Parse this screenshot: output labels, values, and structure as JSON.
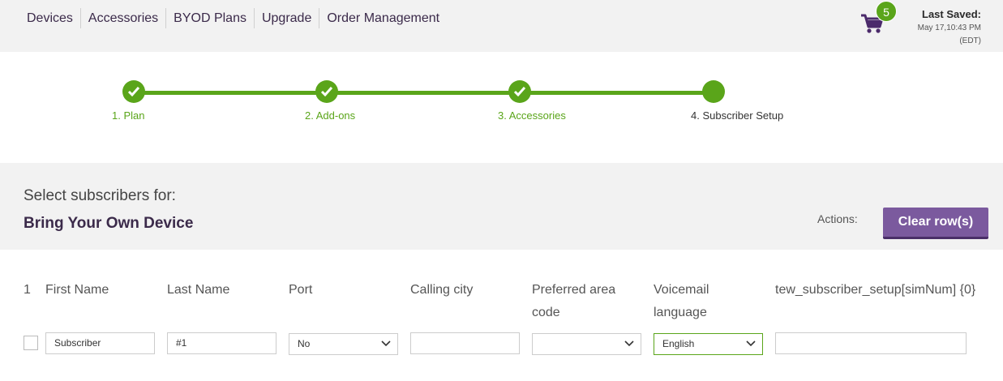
{
  "nav": {
    "items": [
      "Devices",
      "Accessories",
      "BYOD Plans",
      "Upgrade",
      "Order Management"
    ]
  },
  "cart": {
    "count": "5",
    "icon": "cart-icon"
  },
  "last_saved": {
    "title": "Last Saved:",
    "date": "May 17,10:43 PM",
    "tz": "(EDT)"
  },
  "steps": [
    {
      "label": "1. Plan",
      "status": "complete"
    },
    {
      "label": "2. Add-ons",
      "status": "complete"
    },
    {
      "label": "3. Accessories",
      "status": "complete"
    },
    {
      "label": "4. Subscriber Setup",
      "status": "current"
    }
  ],
  "subscriber_header": {
    "prompt": "Select subscribers for:",
    "plan": "Bring Your Own Device",
    "actions_label": "Actions:",
    "clear_button": "Clear row(s)"
  },
  "table": {
    "row_number": "1",
    "columns": [
      "First Name",
      "Last Name",
      "Port",
      "Calling city",
      "Preferred area code",
      "Voicemail language",
      "tew_subscriber_setup[simNum] {0}"
    ],
    "row": {
      "first_name": "Subscriber",
      "last_name": "#1",
      "port": "No",
      "calling_city": "",
      "preferred_area_code": "",
      "voicemail_language": "English",
      "sim_num": ""
    }
  },
  "colors": {
    "accent_green": "#5aa51a",
    "brand_purple": "#7b5a9e",
    "nav_text": "#3b2a4a"
  }
}
